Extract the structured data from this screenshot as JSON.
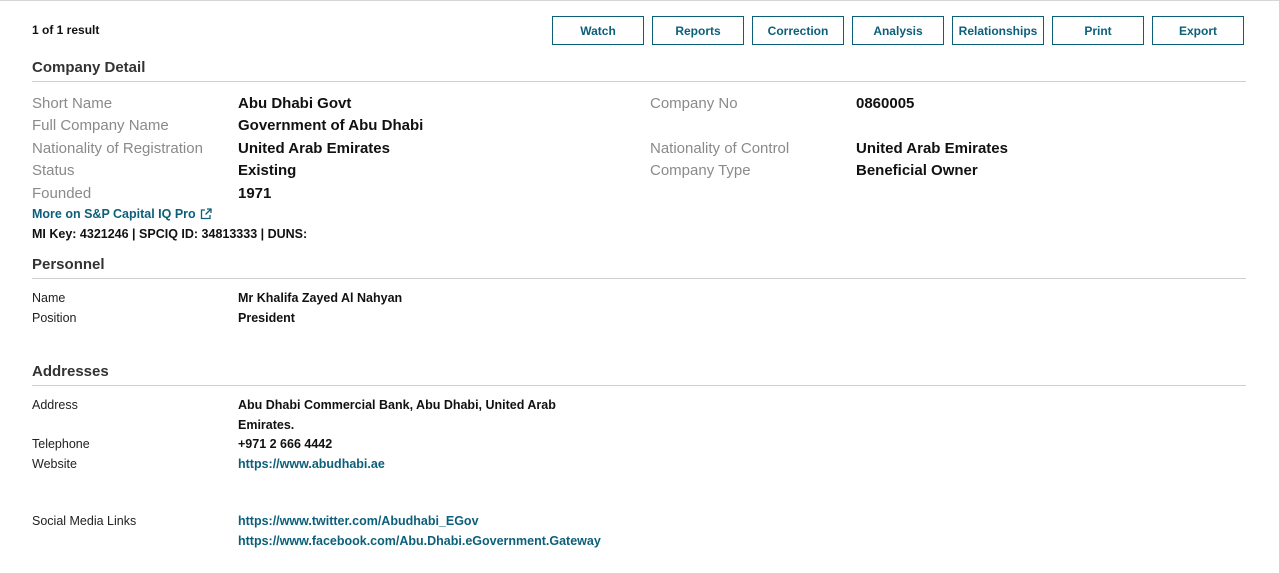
{
  "results": {
    "count_text": "1 of 1 result"
  },
  "toolbar": {
    "watch": "Watch",
    "reports": "Reports",
    "correction": "Correction",
    "analysis": "Analysis",
    "relationships": "Relationships",
    "print": "Print",
    "export": "Export"
  },
  "company": {
    "section_title": "Company Detail",
    "short_name": {
      "label": "Short Name",
      "value": "Abu Dhabi Govt"
    },
    "full_name": {
      "label": "Full Company Name",
      "value": "Government of Abu Dhabi"
    },
    "nat_registration": {
      "label": "Nationality of Registration",
      "value": "United Arab Emirates"
    },
    "status": {
      "label": "Status",
      "value": "Existing"
    },
    "founded": {
      "label": "Founded",
      "value": "1971"
    },
    "company_no": {
      "label": "Company No",
      "value": "0860005"
    },
    "nat_control": {
      "label": "Nationality of Control",
      "value": "United Arab Emirates"
    },
    "company_type": {
      "label": "Company Type",
      "value": "Beneficial Owner"
    },
    "capiq_link": "More on S&P Capital IQ Pro",
    "keys_line": "MI Key: 4321246 | SPCIQ ID: 34813333 | DUNS:"
  },
  "personnel": {
    "section_title": "Personnel",
    "name": {
      "label": "Name",
      "value": "Mr Khalifa Zayed Al Nahyan"
    },
    "position": {
      "label": "Position",
      "value": "President"
    }
  },
  "addresses": {
    "section_title": "Addresses",
    "address": {
      "label": "Address",
      "line1": "Abu Dhabi Commercial Bank, Abu Dhabi, United Arab",
      "line2": "Emirates."
    },
    "telephone": {
      "label": "Telephone",
      "value": "+971 2 666 4442"
    },
    "website": {
      "label": "Website",
      "value": "https://www.abudhabi.ae"
    },
    "social": {
      "label": "Social Media Links",
      "twitter": "https://www.twitter.com/Abudhabi_EGov",
      "facebook": "https://www.facebook.com/Abu.Dhabi.eGovernment.Gateway"
    }
  },
  "colors": {
    "accent": "#0c5f7a",
    "label_gray": "#8a8a8a",
    "rule": "#cfcfcf"
  }
}
